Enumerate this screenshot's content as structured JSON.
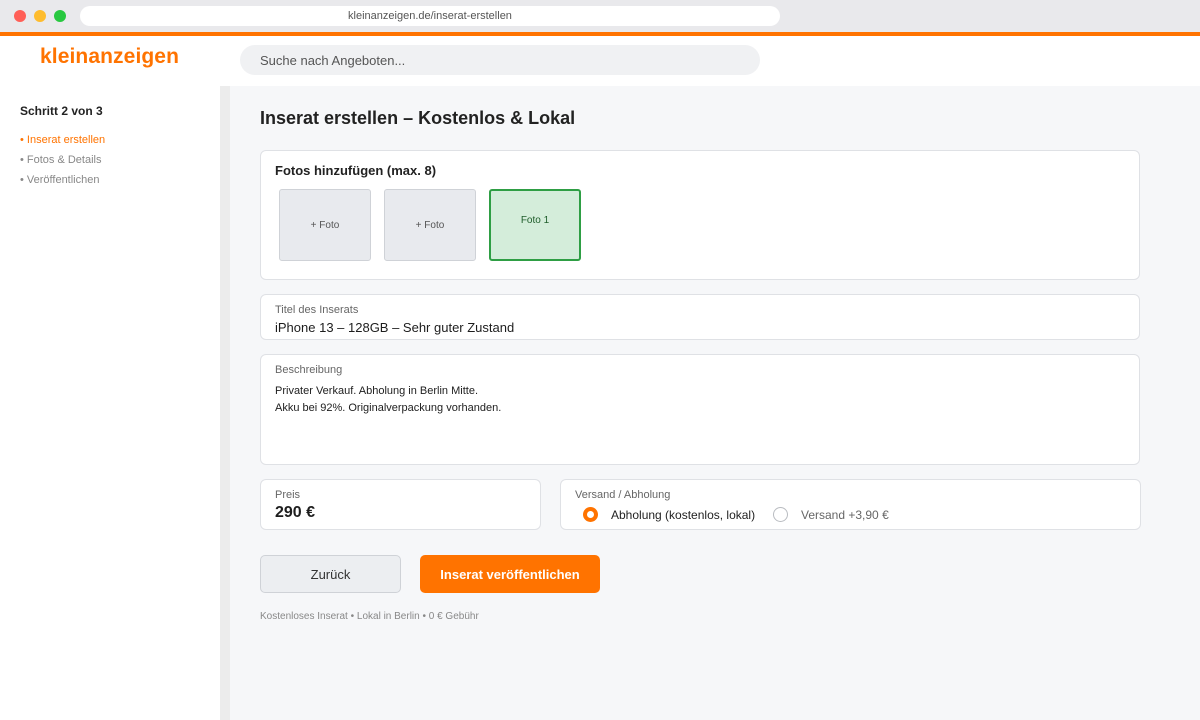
{
  "browser": {
    "url": "kleinanzeigen.de/inserat-erstellen"
  },
  "header": {
    "logo": "kleinanzeigen",
    "search_placeholder": "Suche nach Angeboten..."
  },
  "sidebar": {
    "step_title": "Schritt 2 von 3",
    "steps": [
      {
        "label": "• Inserat erstellen",
        "active": true
      },
      {
        "label": "• Fotos & Details",
        "active": false
      },
      {
        "label": "• Veröffentlichen",
        "active": false
      }
    ]
  },
  "main": {
    "page_title": "Inserat erstellen – Kostenlos & Lokal",
    "photos": {
      "title": "Fotos hinzufügen (max. 8)",
      "slots": [
        "+ Foto",
        "+ Foto",
        "Foto 1"
      ]
    },
    "title_field": {
      "label": "Titel des Inserats",
      "value": "iPhone 13 – 128GB – Sehr guter Zustand"
    },
    "description": {
      "label": "Beschreibung",
      "value": "Privater Verkauf. Abholung in Berlin Mitte.\nAkku bei 92%. Originalverpackung vorhanden."
    },
    "price": {
      "label": "Preis",
      "value": "290 €"
    },
    "shipping": {
      "label": "Versand / Abholung",
      "options": [
        {
          "label": "Abholung (kostenlos, lokal)",
          "selected": true
        },
        {
          "label": "Versand +3,90 €",
          "selected": false
        }
      ]
    },
    "buttons": {
      "back": "Zurück",
      "publish": "Inserat veröffentlichen"
    },
    "footnote": "Kostenloses Inserat • Lokal in Berlin • 0 € Gebühr"
  },
  "colors": {
    "brand": "#ff7300",
    "photo_filled_bg": "#d4edda",
    "photo_filled_border": "#2e9e44"
  }
}
